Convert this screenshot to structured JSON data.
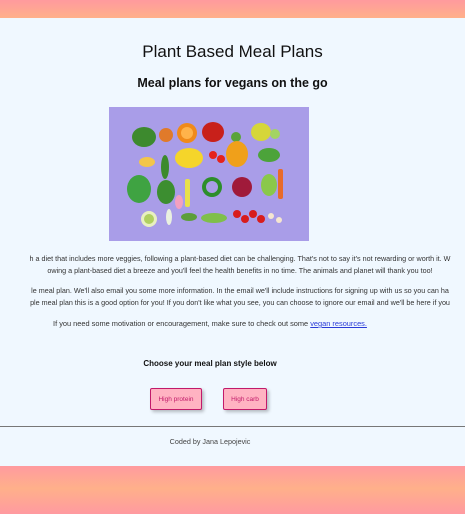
{
  "header": {
    "title": "Plant Based Meal Plans",
    "subtitle": "Meal plans for vegans on the go"
  },
  "hero_image": {
    "icon": "vegetables-flatlay-image"
  },
  "intro": {
    "line1": "h a diet that includes more veggies, following a plant-based diet can be challenging. That's not to say it's not rewarding or worth it. W",
    "line2": "owing a plant-based diet a breeze and you'll feel the health benefits in no time. The animals and planet will thank you too!",
    "line3": "le meal plan. We'll also email you some more information. In the email we'll include instructions for signing up with us so you can ha",
    "line4": "ple meal plan this is a good option for you! If you don't like what you see, you can choose to ignore our email and we'll be here if you",
    "line5_text": "If you need some motivation or encouragement, make sure to check out some",
    "line5_link": "vegan resources."
  },
  "choose": {
    "label": "Choose your meal plan style below"
  },
  "buttons": {
    "high_protein": "High protein",
    "high_carb": "High carb"
  },
  "footer": {
    "credit": "Coded by Jana Lepojevic"
  },
  "colors": {
    "background": "#f0f8ff",
    "accent": "#c21a6a",
    "button_fill": "#ffb3c2",
    "gradient_top": "#ff9a9e"
  }
}
